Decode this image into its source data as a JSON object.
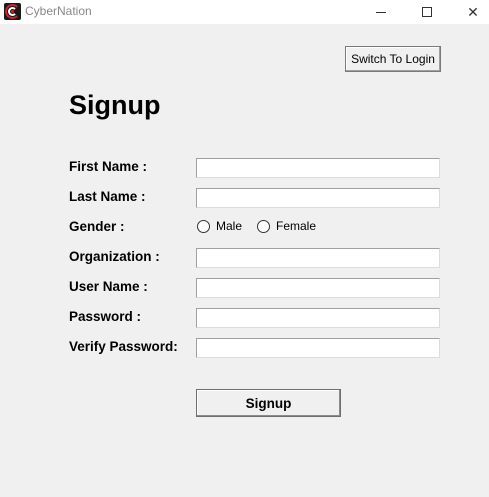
{
  "window": {
    "title": "CyberNation",
    "controls": {
      "minimize_icon": "minimize-icon",
      "maximize_icon": "maximize-icon",
      "close_icon": "close-icon",
      "close_glyph": "✕"
    }
  },
  "header": {
    "switch_label": "Switch To Login"
  },
  "form": {
    "title": "Signup",
    "labels": {
      "first_name": "First Name :",
      "last_name": "Last Name :",
      "gender": "Gender :",
      "organization": "Organization :",
      "username": "User Name :",
      "password": "Password :",
      "verify_password": "Verify Password:"
    },
    "values": {
      "first_name": "",
      "last_name": "",
      "organization": "",
      "username": "",
      "password": "",
      "verify_password": ""
    },
    "gender_options": {
      "male": "Male",
      "female": "Female"
    },
    "submit_label": "Signup"
  },
  "colors": {
    "background": "#f0f0f0",
    "titlebar": "#ffffff",
    "icon_accent": "#d21f2b"
  }
}
